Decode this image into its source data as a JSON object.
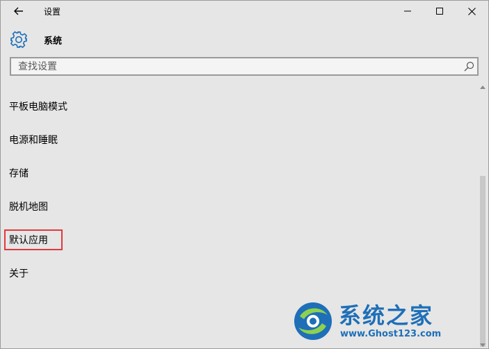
{
  "window": {
    "app_title": "设置"
  },
  "section": {
    "title": "系统"
  },
  "search": {
    "placeholder": "查找设置",
    "value": ""
  },
  "menu_items": [
    {
      "label": "平板电脑模式"
    },
    {
      "label": "电源和睡眠"
    },
    {
      "label": "存储"
    },
    {
      "label": "脱机地图"
    },
    {
      "label": "默认应用",
      "highlighted": true
    },
    {
      "label": "关于"
    }
  ],
  "watermark": {
    "title": "系统之家",
    "url": "www.Ghost123.com"
  },
  "colors": {
    "background": "#e6e6e6",
    "accent": "#1e6fb8",
    "highlight_border": "#e0393e"
  },
  "icons": {
    "back": "arrow-left-icon",
    "minimize": "minimize-icon",
    "maximize": "maximize-icon",
    "close": "close-icon",
    "section": "gear-icon",
    "search": "search-icon"
  }
}
